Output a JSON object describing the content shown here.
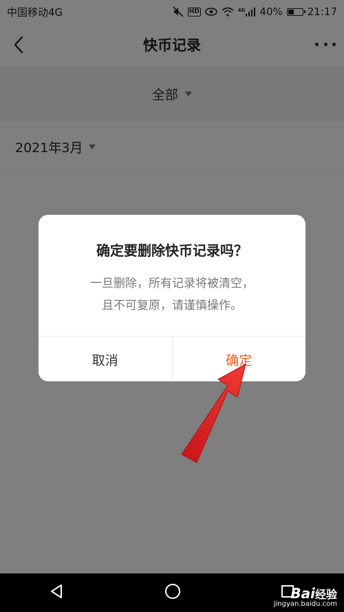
{
  "status_bar": {
    "carrier": "中国移动4G",
    "battery": "40%",
    "battery_level": 0.4,
    "time": "21:17",
    "icons": [
      "mute-icon",
      "hd-icon",
      "eye-icon",
      "wifi-icon",
      "signal-icon",
      "battery-icon"
    ],
    "hd_label": "HD",
    "network_label": "4G"
  },
  "header": {
    "title": "快币记录",
    "back_icon": "chevron-left-icon",
    "more_icon": "more-icon"
  },
  "filter": {
    "selected": "全部"
  },
  "month_selector": {
    "selected": "2021年3月"
  },
  "dialog": {
    "title": "确定要删除快币记录吗？",
    "message_line1": "一旦删除，所有记录将被清空，",
    "message_line2": "且不可复原，请谨慎操作。",
    "cancel_label": "取消",
    "confirm_label": "确定"
  },
  "nav_bar": {
    "icons": [
      "back-triangle-icon",
      "home-circle-icon",
      "recents-square-icon"
    ]
  },
  "watermark": {
    "logo": "Bai",
    "logo_suffix": "经验",
    "url": "jingyan.baidu.com"
  },
  "colors": {
    "accent": "#f25a1d",
    "annotation_arrow": "#e8201f",
    "overlay": "rgba(0,0,0,0.5)"
  }
}
